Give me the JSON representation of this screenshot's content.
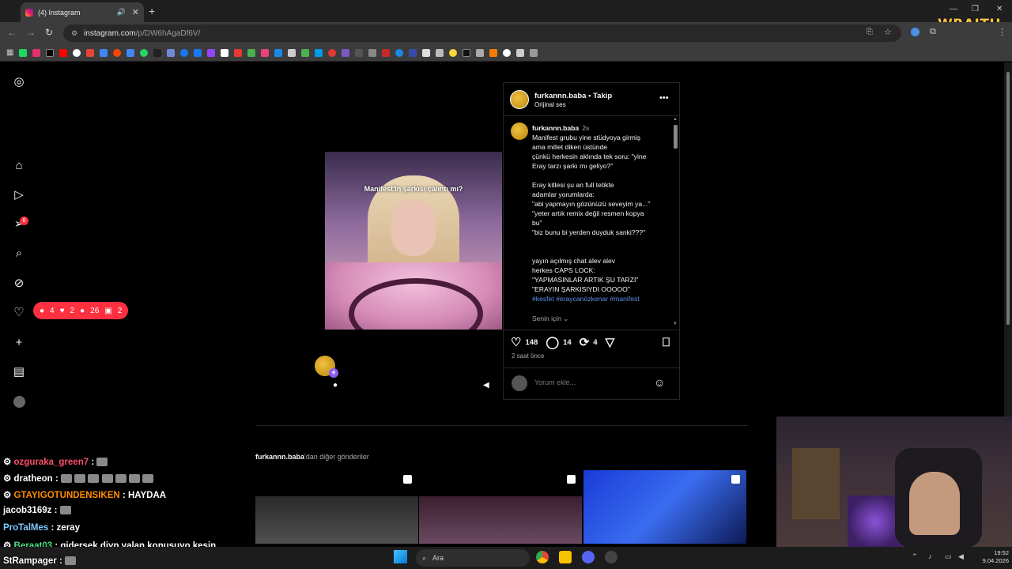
{
  "browser": {
    "tab_title": "(4) Instagram",
    "url_site": "instagram.com",
    "url_path": "/p/DW6hAgaDf6V/",
    "overlay_brand": "WRAITH"
  },
  "sidebar": {
    "notification_count": "6"
  },
  "activity_pill": {
    "comments": "4",
    "likes": "2",
    "followers": "26",
    "requests": "2"
  },
  "post": {
    "username": "furkannn.baba",
    "follow_label": "Takip",
    "audio_label": "Orijinal ses",
    "video_overlay_text": "Manifest'in şarkısı çalıntı mı?",
    "caption_time": "2s",
    "caption_lines": [
      "Manifest grubu yine stüdyoya girmiş",
      "ama millet diken üstünde",
      "çünkü herkesin aklında tek soru: \"yine",
      "Eray tarzı şarkı mı geliyo?\"",
      "",
      "Eray kitlesi şu an full tetikte",
      "adamlar yorumlarda:",
      "\"abi yapmayın gözünüzü seveyim ya...\"",
      "\"yeter artık remix değil resmen kopya",
      "bu\"",
      "\"biz bunu bi yerden duyduk sanki???\"",
      "",
      "",
      "yayın açılmış chat alev alev",
      "herkes CAPS LOCK:",
      "\"YAPMASINLAR ARTIK ŞU TARZI\"",
      "\"ERAYIN ŞARKISIYDI OOOOO\""
    ],
    "hashtags": "#kesfet #eraycanözkenar #manifest",
    "see_translation": "Senin için",
    "likes": "148",
    "comments": "14",
    "reposts": "4",
    "time_ago": "2 saat önce",
    "comment_placeholder": "Yorum ekle..."
  },
  "more_posts": {
    "username": "furkannn.baba",
    "suffix": "'dan diğer gönderiler"
  },
  "chat": [
    {
      "user": "ozguraka_green7",
      "msg": "",
      "color": "#ff4f6b"
    },
    {
      "user": "dratheon",
      "msg": "",
      "color": "#ffffff"
    },
    {
      "user": "GTAYIGOTUNDENSIKEN",
      "msg": "HAYDAA",
      "color": "#ff8c00"
    },
    {
      "user": "jacob3169z",
      "msg": "",
      "color": "#ffffff"
    },
    {
      "user": "ProTalMes",
      "msg": "zeray",
      "color": "#7ec8ff"
    },
    {
      "user": "Beraat03",
      "msg": "gidersek diyp yalan konuşuyo kesin",
      "color": "#4ade80"
    },
    {
      "user": "StRampager",
      "msg": "",
      "color": "#ffffff"
    }
  ],
  "taskbar": {
    "search_placeholder": "Ara",
    "time": "19:52",
    "date": "9.04.2026"
  },
  "colors": {
    "accent_red": "#ff3040",
    "link_blue": "#5b8fe8",
    "brand_yellow": "#f6c343"
  }
}
